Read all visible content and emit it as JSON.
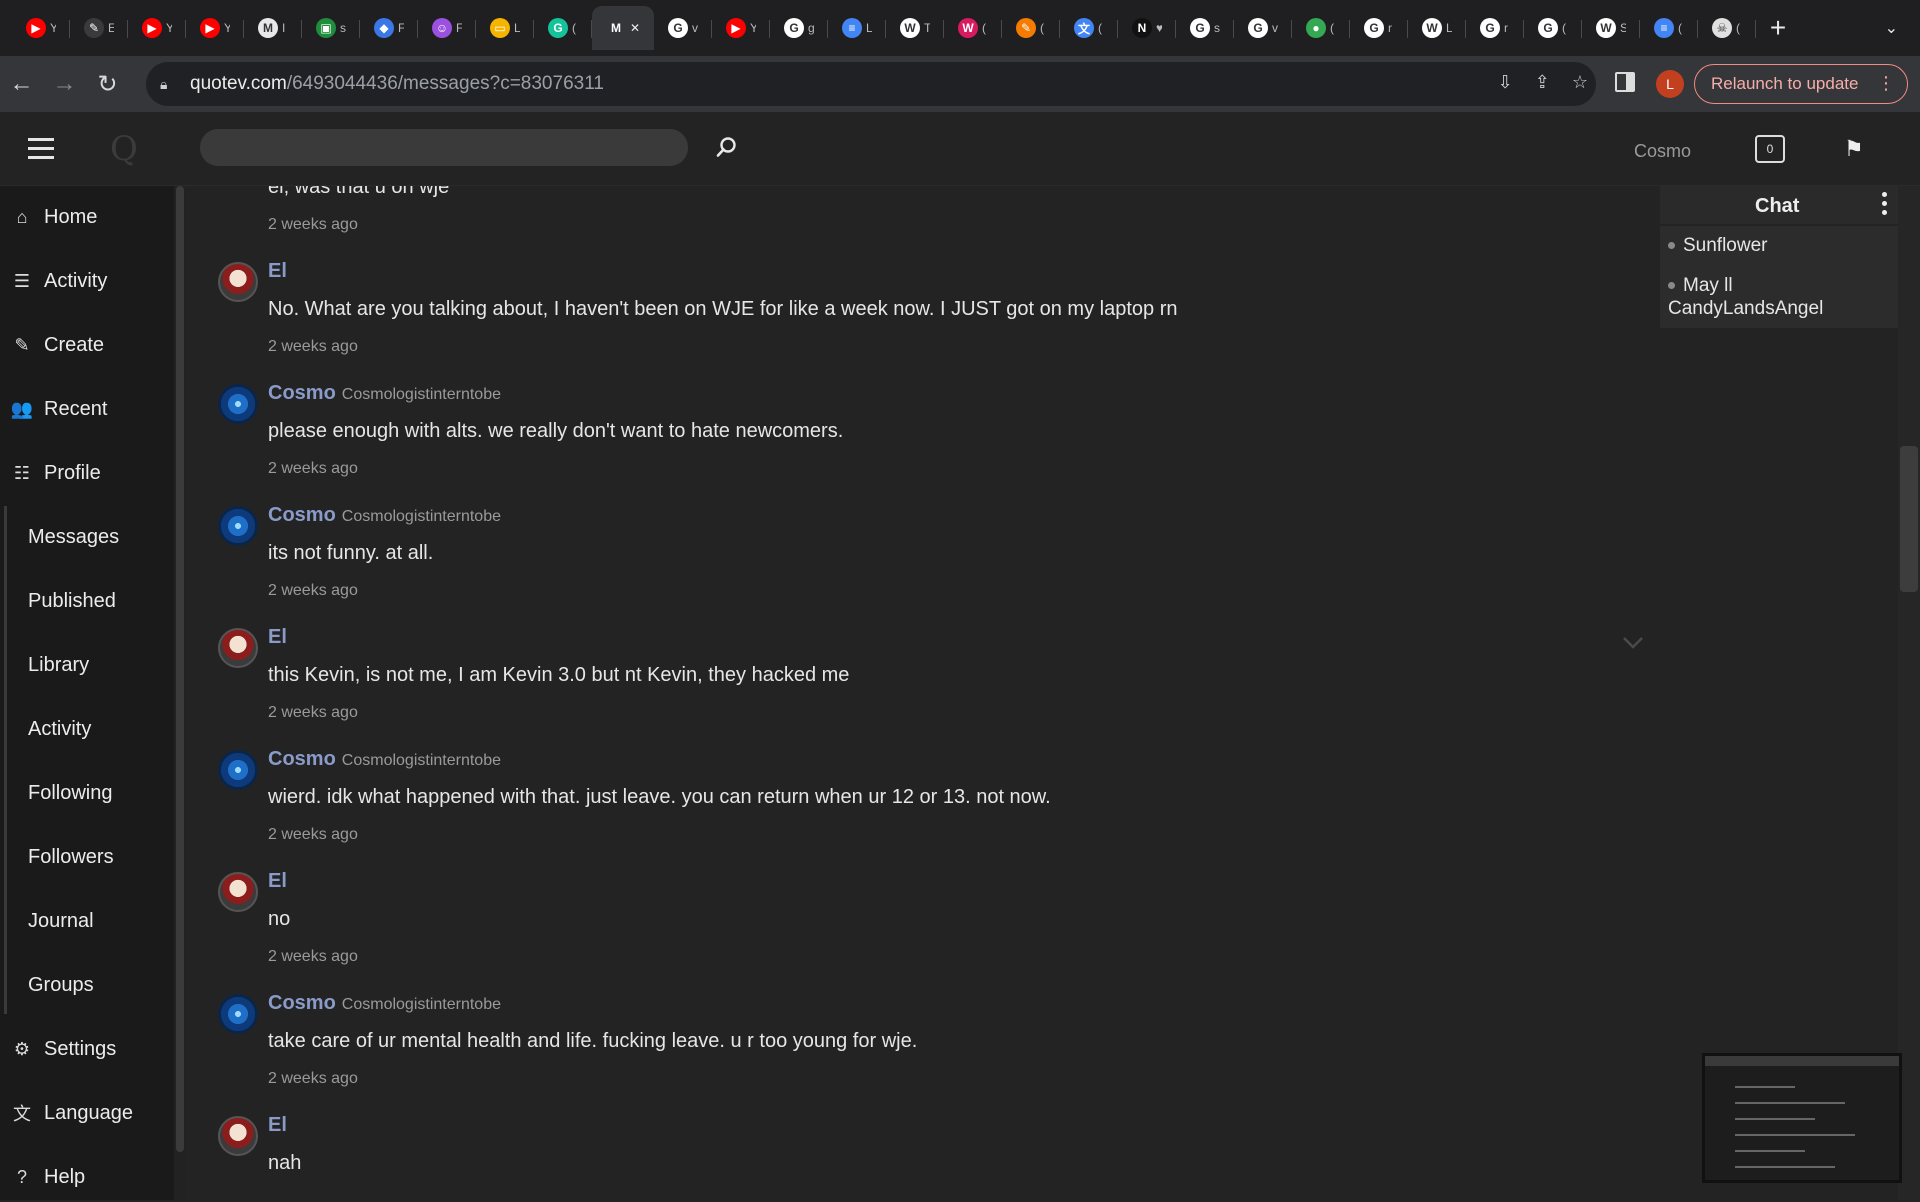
{
  "browser": {
    "tabs": [
      {
        "icon": "youtube-icon",
        "color": "#ff0000",
        "glyph": "▶",
        "title": "Y"
      },
      {
        "icon": "pencil-icon",
        "color": "#3a3a3a",
        "glyph": "✎",
        "title": "E"
      },
      {
        "icon": "youtube-icon",
        "color": "#ff0000",
        "glyph": "▶",
        "title": "Y"
      },
      {
        "icon": "youtube-icon",
        "color": "#ff0000",
        "glyph": "▶",
        "title": "Y"
      },
      {
        "icon": "gmail-icon",
        "color": "#e8e8e8",
        "glyph": "M",
        "title": "I"
      },
      {
        "icon": "chat-icon",
        "color": "#1e8e3e",
        "glyph": "▣",
        "title": "s"
      },
      {
        "icon": "cap-icon",
        "color": "#3b78e7",
        "glyph": "◆",
        "title": "F"
      },
      {
        "icon": "bot-icon",
        "color": "#9b51e0",
        "glyph": "☺",
        "title": "F"
      },
      {
        "icon": "slides-icon",
        "color": "#f4b400",
        "glyph": "▭",
        "title": "L"
      },
      {
        "icon": "grammarly-icon",
        "color": "#15c39a",
        "glyph": "G",
        "title": "("
      },
      {
        "icon": "quotev-icon",
        "color": "#35363a",
        "glyph": "M",
        "title": "✕"
      },
      {
        "icon": "google-icon",
        "color": "#ffffff",
        "glyph": "G",
        "title": "v"
      },
      {
        "icon": "youtube-icon",
        "color": "#ff0000",
        "glyph": "▶",
        "title": "Y"
      },
      {
        "icon": "google-icon",
        "color": "#ffffff",
        "glyph": "G",
        "title": "g"
      },
      {
        "icon": "docs-icon",
        "color": "#4285f4",
        "glyph": "≡",
        "title": "L"
      },
      {
        "icon": "wikipedia-icon",
        "color": "#ffffff",
        "glyph": "W",
        "title": "T"
      },
      {
        "icon": "wattpad-icon",
        "color": "#d81b60",
        "glyph": "W",
        "title": "("
      },
      {
        "icon": "pencil-icon",
        "color": "#f57c00",
        "glyph": "✎",
        "title": "("
      },
      {
        "icon": "translate-icon",
        "color": "#4285f4",
        "glyph": "文",
        "title": "("
      },
      {
        "icon": "notion-icon",
        "color": "#111111",
        "glyph": "N",
        "title": "♥"
      },
      {
        "icon": "google-icon",
        "color": "#ffffff",
        "glyph": "G",
        "title": "s"
      },
      {
        "icon": "google-icon",
        "color": "#ffffff",
        "glyph": "G",
        "title": "v"
      },
      {
        "icon": "maps-icon",
        "color": "#34a853",
        "glyph": "●",
        "title": "("
      },
      {
        "icon": "google-icon",
        "color": "#ffffff",
        "glyph": "G",
        "title": "r"
      },
      {
        "icon": "wikipedia-icon",
        "color": "#ffffff",
        "glyph": "W",
        "title": "L"
      },
      {
        "icon": "google-icon",
        "color": "#ffffff",
        "glyph": "G",
        "title": "r"
      },
      {
        "icon": "google-icon",
        "color": "#ffffff",
        "glyph": "G",
        "title": "("
      },
      {
        "icon": "wikipedia-icon",
        "color": "#ffffff",
        "glyph": "W",
        "title": "S"
      },
      {
        "icon": "docs-icon",
        "color": "#4285f4",
        "glyph": "≡",
        "title": "("
      },
      {
        "icon": "skull-icon",
        "color": "#e0e0e0",
        "glyph": "☠",
        "title": "("
      }
    ],
    "active_tab_index": 10,
    "url_host": "quotev.com",
    "url_path": "/6493044436/messages?c=83076311",
    "profile_initial": "L",
    "relaunch_label": "Relaunch to update",
    "new_tab": "+",
    "tab_menu": "⌄"
  },
  "site": {
    "logo": "Q",
    "search_placeholder": "",
    "username": "Cosmo",
    "notification_count": "0"
  },
  "nav": {
    "main": [
      {
        "icon": "home-icon",
        "glyph": "⌂",
        "label": "Home"
      },
      {
        "icon": "activity-icon",
        "glyph": "☰",
        "label": "Activity"
      },
      {
        "icon": "create-icon",
        "glyph": "✎",
        "label": "Create"
      },
      {
        "icon": "recent-icon",
        "glyph": "👥",
        "label": "Recent"
      },
      {
        "icon": "profile-icon",
        "glyph": "☷",
        "label": "Profile"
      }
    ],
    "sub": [
      "Messages",
      "Published",
      "Library",
      "Activity",
      "Following",
      "Followers",
      "Journal",
      "Groups"
    ],
    "bottom": [
      {
        "icon": "settings-icon",
        "glyph": "⚙",
        "label": "Settings"
      },
      {
        "icon": "language-icon",
        "glyph": "文",
        "label": "Language"
      },
      {
        "icon": "help-icon",
        "glyph": "?",
        "label": "Help"
      }
    ]
  },
  "messages": [
    {
      "author": "",
      "handle": "",
      "avatar": "",
      "text": "el, was that u on wje",
      "time": "2 weeks ago"
    },
    {
      "author": "El",
      "handle": "",
      "avatar": "el",
      "text": "No. What are you talking about, I haven't been on WJE for like a week now. I JUST got on my laptop rn",
      "time": "2 weeks ago"
    },
    {
      "author": "Cosmo",
      "handle": "Cosmologistinterntobe",
      "avatar": "cosmo",
      "text": "please enough with alts. we really don't want to hate newcomers.",
      "time": "2 weeks ago"
    },
    {
      "author": "Cosmo",
      "handle": "Cosmologistinterntobe",
      "avatar": "cosmo",
      "text": "its not funny. at all.",
      "time": "2 weeks ago"
    },
    {
      "author": "El",
      "handle": "",
      "avatar": "el",
      "text": "this Kevin, is not me, I am Kevin 3.0 but nt Kevin, they hacked me",
      "time": "2 weeks ago"
    },
    {
      "author": "Cosmo",
      "handle": "Cosmologistinterntobe",
      "avatar": "cosmo",
      "text": "wierd. idk what happened with that. just leave. you can return when ur 12 or 13. not now.",
      "time": "2 weeks ago"
    },
    {
      "author": "El",
      "handle": "",
      "avatar": "el",
      "text": "no",
      "time": "2 weeks ago"
    },
    {
      "author": "Cosmo",
      "handle": "Cosmologistinterntobe",
      "avatar": "cosmo",
      "text": "take care of ur mental health and life. fucking leave. u r too young for wje.",
      "time": "2 weeks ago"
    },
    {
      "author": "El",
      "handle": "",
      "avatar": "el",
      "text": "nah",
      "time": ""
    }
  ],
  "chat": {
    "title": "Chat",
    "items": [
      "Sunflower",
      "May ll CandyLandsAngel"
    ]
  }
}
